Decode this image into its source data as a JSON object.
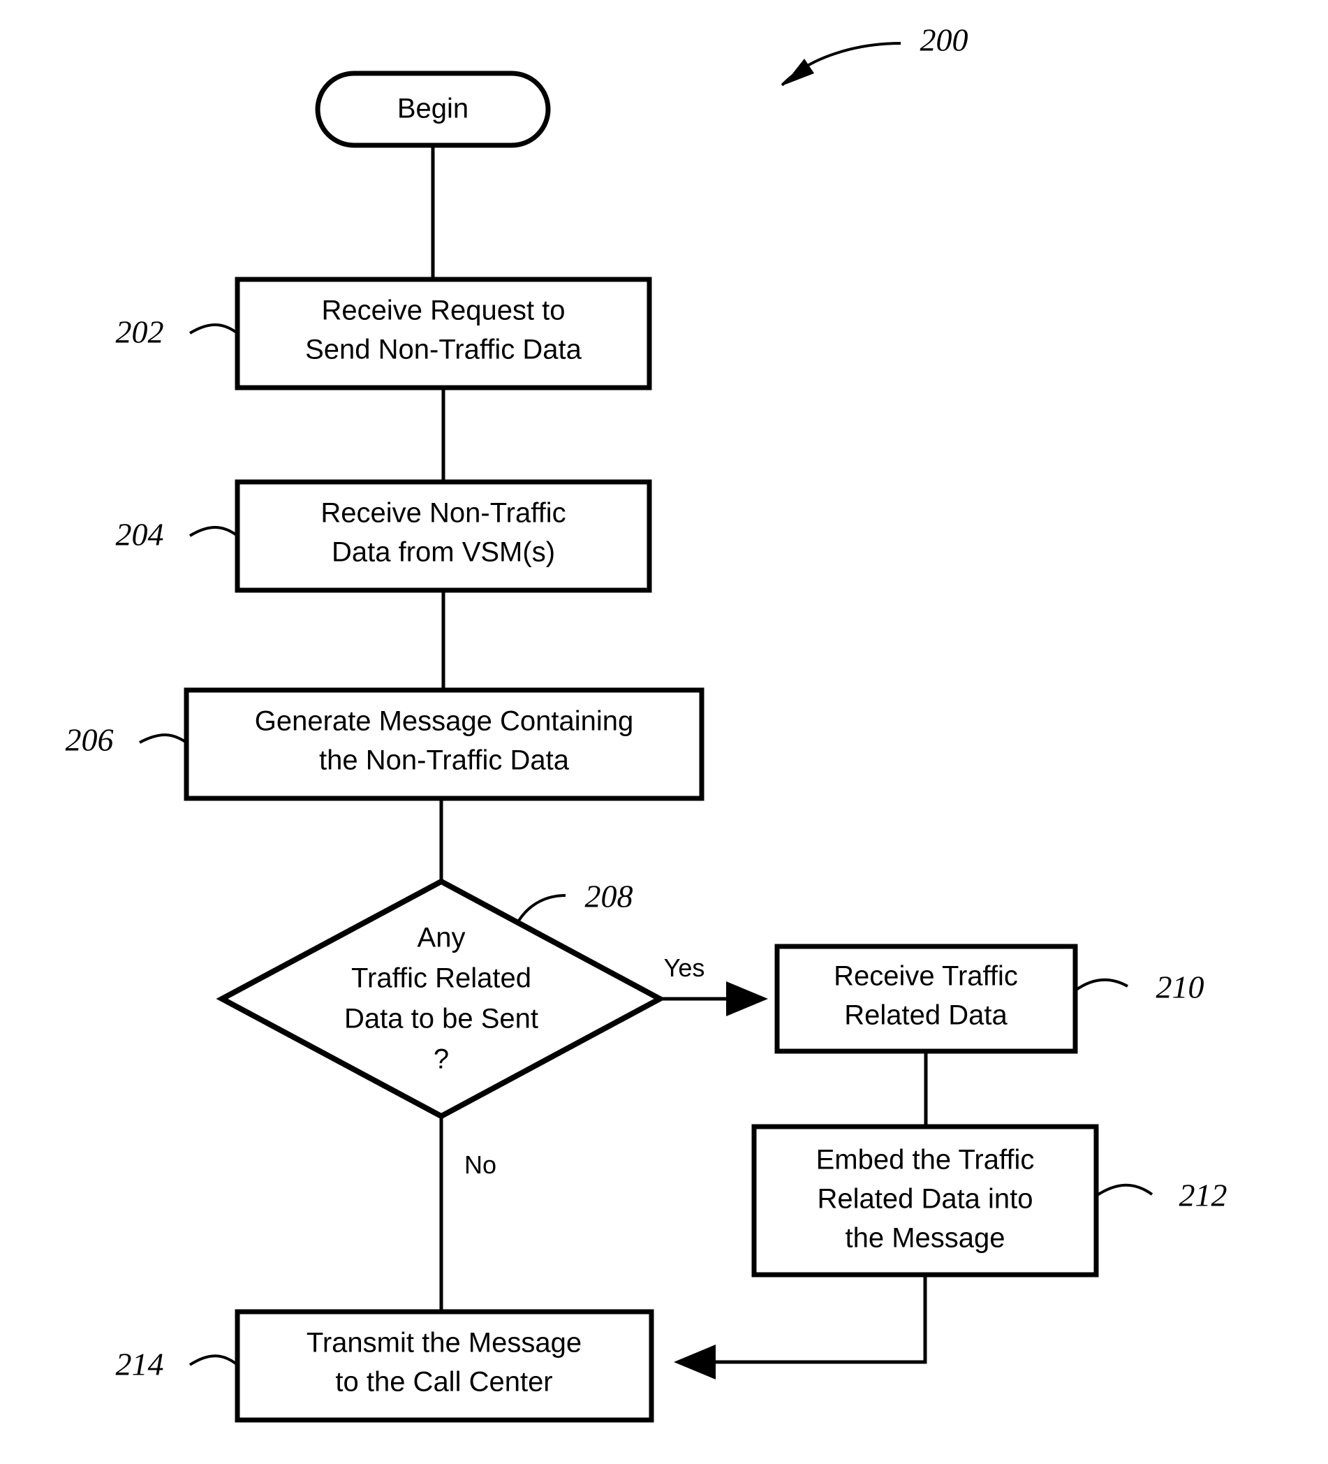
{
  "figure": {
    "reference_numeral": "200",
    "type": "flowchart"
  },
  "nodes": {
    "begin": {
      "label": "Begin",
      "shape": "stadium"
    },
    "step_202": {
      "ref": "202",
      "line1": "Receive Request to",
      "line2": "Send Non-Traffic Data",
      "shape": "rectangle"
    },
    "step_204": {
      "ref": "204",
      "line1": "Receive Non-Traffic",
      "line2": "Data from VSM(s)",
      "shape": "rectangle"
    },
    "step_206": {
      "ref": "206",
      "line1": "Generate Message Containing",
      "line2": "the Non-Traffic Data",
      "shape": "rectangle"
    },
    "decision_208": {
      "ref": "208",
      "line1": "Any",
      "line2": "Traffic Related",
      "line3": "Data to be Sent",
      "line4": "?",
      "shape": "diamond"
    },
    "step_210": {
      "ref": "210",
      "line1": "Receive Traffic",
      "line2": "Related Data",
      "shape": "rectangle"
    },
    "step_212": {
      "ref": "212",
      "line1": "Embed the Traffic",
      "line2": "Related Data into",
      "line3": "the Message",
      "shape": "rectangle"
    },
    "step_214": {
      "ref": "214",
      "line1": "Transmit the Message",
      "line2": "to the Call Center",
      "shape": "rectangle"
    }
  },
  "edges": {
    "yes_label": "Yes",
    "no_label": "No"
  },
  "colors": {
    "stroke": "#000000",
    "fill": "#ffffff",
    "background": "#ffffff"
  }
}
